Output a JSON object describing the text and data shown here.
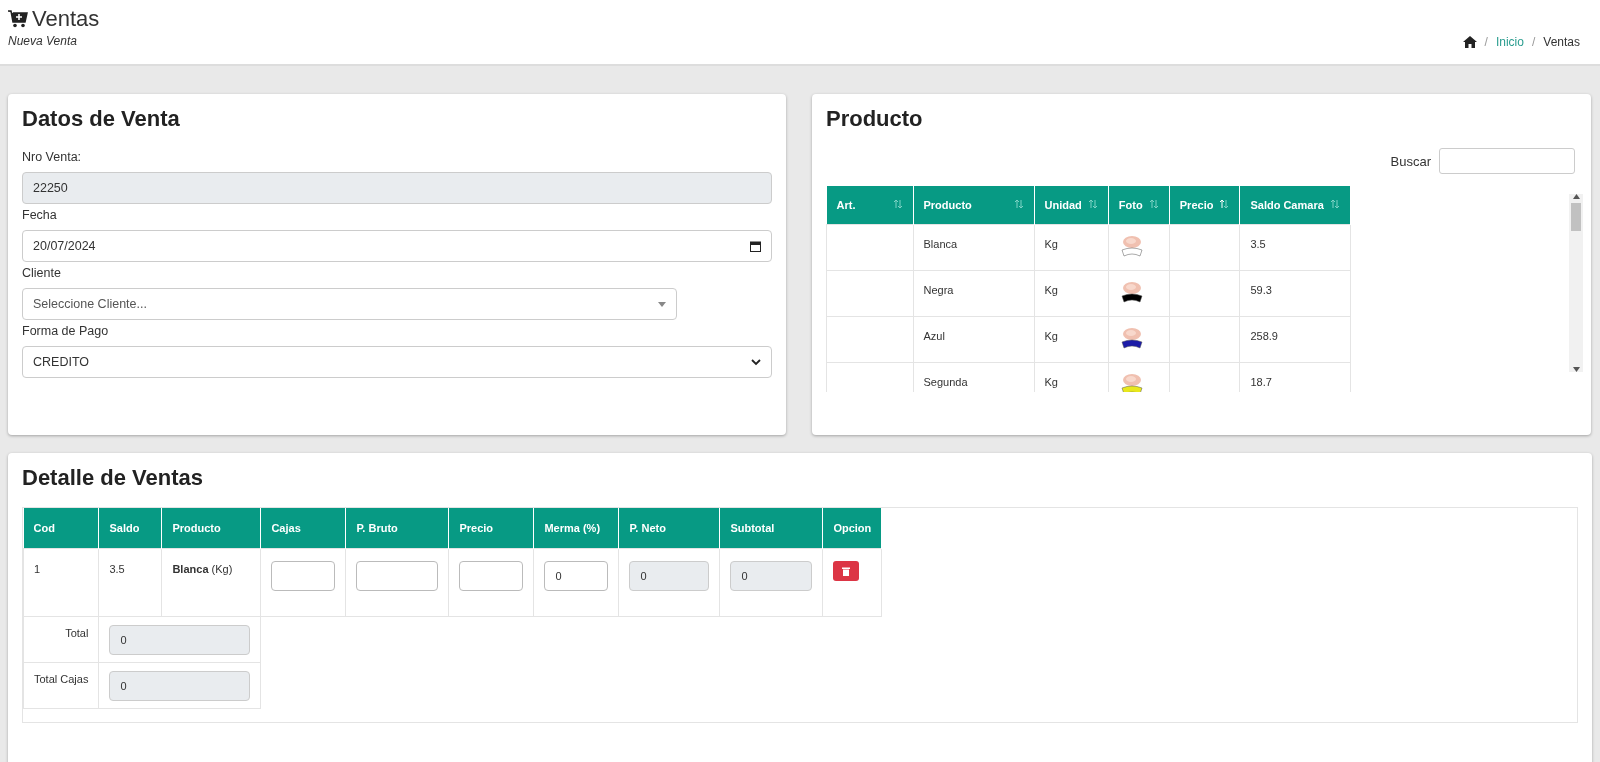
{
  "header": {
    "title": "Ventas",
    "subtitle": "Nueva Venta",
    "separator": "/",
    "breadcrumb": [
      {
        "label": "Inicio",
        "link": true
      },
      {
        "label": "Ventas",
        "link": false
      }
    ]
  },
  "sale_form": {
    "title": "Datos de Venta",
    "fields": [
      {
        "label": "Nro Venta:",
        "kind": "text",
        "value": "22250",
        "disabled": true
      },
      {
        "label": "Fecha",
        "kind": "date",
        "value": "20/07/2024",
        "disabled": false
      },
      {
        "label": "Cliente",
        "kind": "combo",
        "placeholder": "Seleccione Cliente...",
        "disabled": false
      },
      {
        "label": "Forma de Pago",
        "kind": "select",
        "value": "CREDITO",
        "disabled": false
      }
    ]
  },
  "products": {
    "title": "Producto",
    "search_label": "Buscar",
    "columns": [
      {
        "label": "Art.",
        "sorted": false
      },
      {
        "label": "Producto",
        "sorted": false
      },
      {
        "label": "Unidad",
        "sorted": false
      },
      {
        "label": "Foto",
        "sorted": false
      },
      {
        "label": "Precio",
        "sorted": true
      },
      {
        "label": "Saldo Camara",
        "sorted": false
      }
    ],
    "rows": [
      {
        "producto": "Blanca",
        "unidad": "Kg",
        "color": "#ffffff",
        "saldo": "3.5"
      },
      {
        "producto": "Negra",
        "unidad": "Kg",
        "color": "#000000",
        "saldo": "59.3"
      },
      {
        "producto": "Azul",
        "unidad": "Kg",
        "color": "#1c1ca8",
        "saldo": "258.9"
      },
      {
        "producto": "Segunda",
        "unidad": "Kg",
        "color": "#e8e81c",
        "saldo": "18.7"
      }
    ]
  },
  "detail": {
    "title": "Detalle de Ventas",
    "columns": [
      "Cod",
      "Saldo",
      "Producto",
      "Cajas",
      "P. Bruto",
      "Precio",
      "Merma (%)",
      "P. Neto",
      "Subtotal",
      "Opcion"
    ],
    "rows": [
      [
        {
          "kind": "text",
          "text": "1"
        },
        {
          "kind": "text",
          "text": "3.5"
        },
        {
          "kind": "rich",
          "text": "**Blanca** (Kg)"
        },
        {
          "kind": "input",
          "disabled": false
        },
        {
          "kind": "input",
          "disabled": false
        },
        {
          "kind": "input",
          "disabled": false
        },
        {
          "kind": "input",
          "value": "0",
          "disabled": false
        },
        {
          "kind": "input",
          "value": "0",
          "disabled": true
        },
        {
          "kind": "input",
          "value": "0",
          "disabled": true
        },
        {
          "kind": "delete"
        }
      ]
    ],
    "totals": [
      {
        "label": "Total",
        "value": "0",
        "disabled": true
      },
      {
        "label": "Total Cajas",
        "value": "0",
        "disabled": true
      }
    ]
  }
}
